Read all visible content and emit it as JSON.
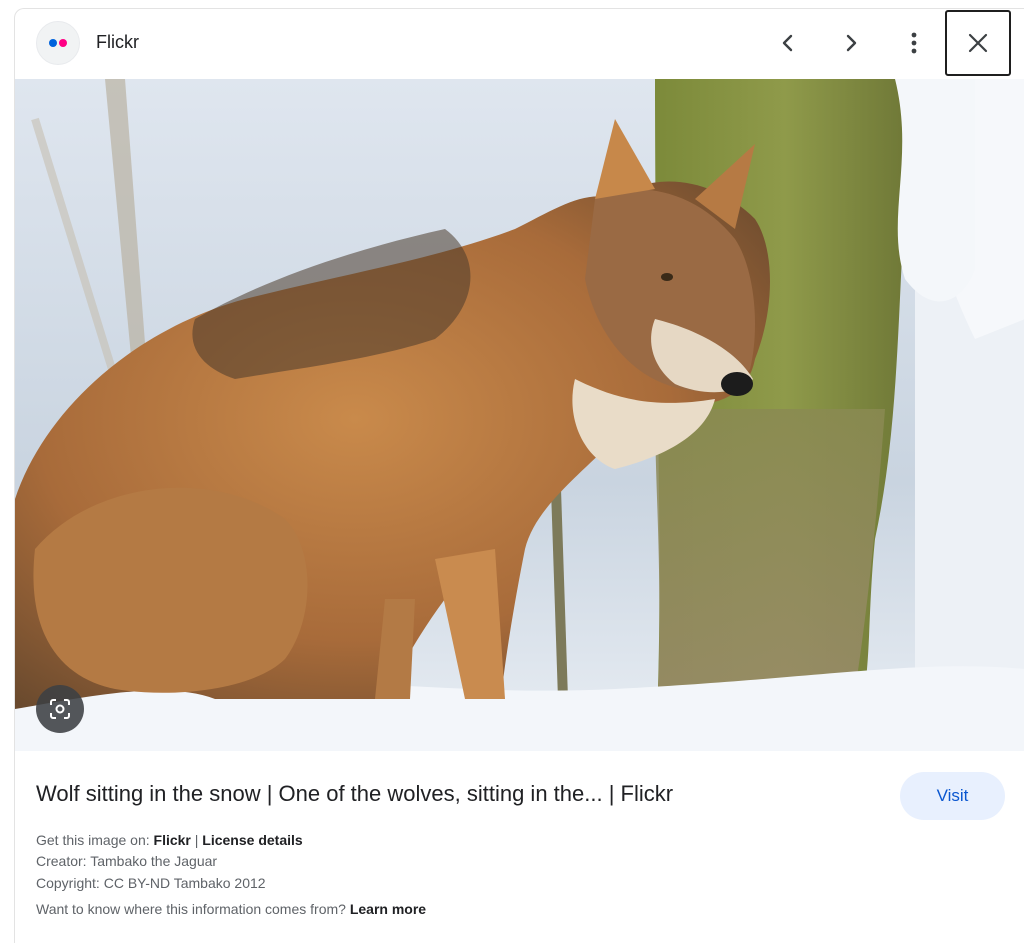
{
  "header": {
    "site_name": "Flickr",
    "logo_dot_colors": [
      "#0063dc",
      "#ff0084"
    ],
    "prev_icon": "chevron-left-icon",
    "next_icon": "chevron-right-icon",
    "more_icon": "more-vert-icon",
    "close_icon": "close-icon"
  },
  "image": {
    "subject": "Wolf sitting in the snow",
    "lens_icon": "lens-search-icon"
  },
  "details": {
    "title": "Wolf sitting in the snow | One of the wolves, sitting in the... | Flickr",
    "visit_label": "Visit",
    "get_image_prefix": "Get this image on: ",
    "get_image_source": "Flickr",
    "separator": " | ",
    "license_link": "License details",
    "creator_label": "Creator: ",
    "creator": "Tambako the Jaguar",
    "copyright_label": "Copyright: ",
    "copyright": "CC BY-ND Tambako 2012",
    "info_question": "Want to know where this information comes from? ",
    "learn_more": "Learn more"
  },
  "colors": {
    "visit_bg": "#e8f0fe",
    "visit_text": "#0b57d0",
    "text_primary": "#202124",
    "text_secondary": "#5f6368"
  }
}
